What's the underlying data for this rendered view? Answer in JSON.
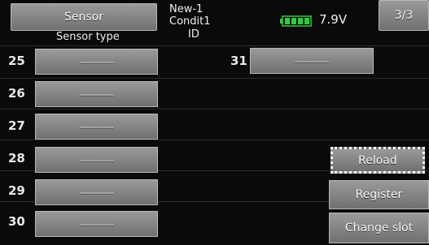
{
  "header": {
    "sensor_button_label": "Sensor",
    "model_name": "New-1",
    "condition": "Condit1",
    "battery_voltage": "7.9V",
    "page_label": "3/3"
  },
  "columns": {
    "sensor_type": "Sensor type",
    "id": "ID"
  },
  "left_slots": [
    {
      "num": "25",
      "value": "------------"
    },
    {
      "num": "26",
      "value": "------------"
    },
    {
      "num": "27",
      "value": "------------"
    },
    {
      "num": "28",
      "value": "------------"
    },
    {
      "num": "29",
      "value": "------------"
    },
    {
      "num": "30",
      "value": "------------"
    }
  ],
  "right_slot": {
    "num": "31",
    "value": "------------"
  },
  "actions": {
    "reload": "Reload",
    "register": "Register",
    "change_slot": "Change slot"
  },
  "colors": {
    "button_top": "#9a9a9a",
    "button_bottom": "#707070",
    "battery": "#2ecc40",
    "background": "#0a0a0a"
  },
  "icons": {
    "battery": "battery-icon"
  }
}
